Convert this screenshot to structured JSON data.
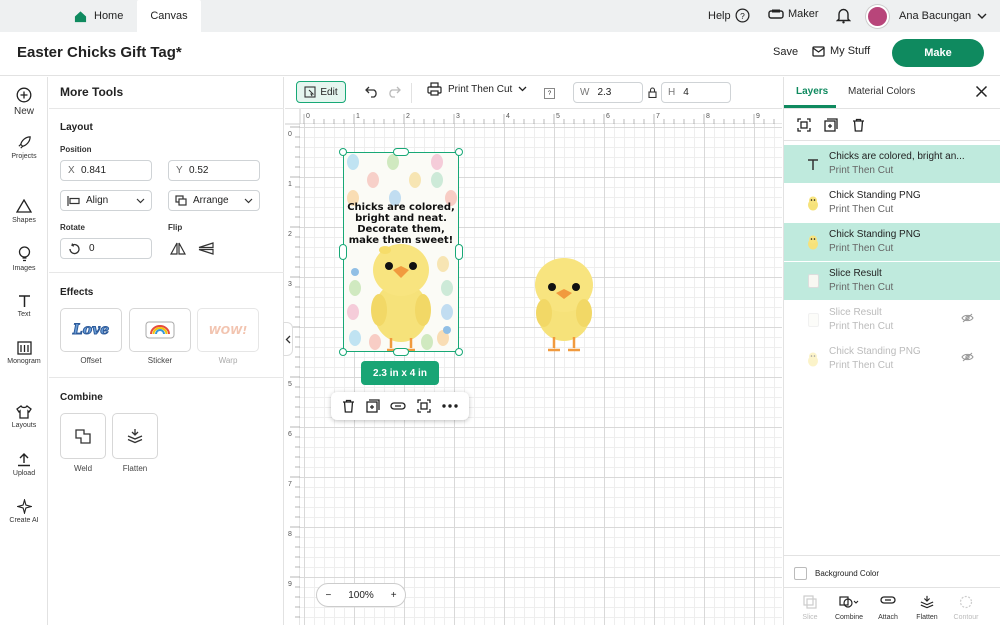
{
  "topbar": {
    "home_label": "Home",
    "canvas_label": "Canvas",
    "help_label": "Help",
    "maker_label": "Maker",
    "user_name": "Ana Bacungan"
  },
  "titlebar": {
    "doc_title": "Easter Chicks Gift Tag*",
    "save_label": "Save",
    "mystuff_label": "My Stuff",
    "make_label": "Make"
  },
  "rail": {
    "items": [
      {
        "label": "New",
        "icon": "plus-circle-icon"
      },
      {
        "label": "Projects",
        "icon": "rocket-icon"
      },
      {
        "label": "Shapes",
        "icon": "shapes-icon"
      },
      {
        "label": "Images",
        "icon": "bulb-icon"
      },
      {
        "label": "Text",
        "icon": "text-icon"
      },
      {
        "label": "Monogram",
        "icon": "monogram-icon"
      },
      {
        "label": "Layouts",
        "icon": "shirt-icon"
      },
      {
        "label": "Upload",
        "icon": "upload-icon"
      },
      {
        "label": "Create AI",
        "icon": "sparkle-icon"
      }
    ]
  },
  "tools": {
    "title": "More Tools",
    "layout_title": "Layout",
    "position_label": "Position",
    "x_prefix": "X",
    "x_value": "0.841",
    "y_prefix": "Y",
    "y_value": "0.52",
    "align_label": "Align",
    "arrange_label": "Arrange",
    "rotate_label": "Rotate",
    "rotate_value": "0",
    "flip_label": "Flip",
    "effects_title": "Effects",
    "offset_label": "Offset",
    "sticker_label": "Sticker",
    "warp_label": "Warp",
    "offset_art": "Love",
    "warp_art": "WOW!",
    "combine_title": "Combine",
    "weld_label": "Weld",
    "flatten_label": "Flatten"
  },
  "canvas": {
    "edit_label": "Edit",
    "operation": "Print Then Cut",
    "help_box": "?",
    "w_prefix": "W",
    "w_value": "2.3",
    "h_prefix": "H",
    "h_value": "4",
    "ruler_h": [
      "0",
      "1",
      "2",
      "3",
      "4",
      "5",
      "6",
      "7",
      "8",
      "9"
    ],
    "ruler_v": [
      "0",
      "1",
      "2",
      "3",
      "4",
      "5",
      "6",
      "7",
      "8",
      "9"
    ],
    "tag_text": "Chicks are colored, bright and neat. Decorate them, make them sweet!",
    "dimensions": "2.3  in x 4  in",
    "zoom": "100%",
    "zoom_minus": "−",
    "zoom_plus": "+"
  },
  "layers_panel": {
    "tab_layers": "Layers",
    "tab_material": "Material Colors",
    "layers": [
      {
        "name": "Chicks are colored, bright an...",
        "op": "Print Then Cut",
        "selected": true,
        "hidden": false,
        "icon": "text-icon"
      },
      {
        "name": "Chick Standing PNG",
        "op": "Print Then Cut",
        "selected": false,
        "hidden": false,
        "icon": "chick-icon"
      },
      {
        "name": "Chick Standing PNG",
        "op": "Print Then Cut",
        "selected": true,
        "hidden": false,
        "icon": "chick-icon"
      },
      {
        "name": "Slice Result",
        "op": "Print Then Cut",
        "selected": true,
        "hidden": false,
        "icon": "slice-icon"
      },
      {
        "name": "Slice Result",
        "op": "Print Then Cut",
        "selected": false,
        "hidden": true,
        "icon": "slice-icon"
      },
      {
        "name": "Chick Standing PNG",
        "op": "Print Then Cut",
        "selected": false,
        "hidden": true,
        "icon": "chick-icon"
      }
    ],
    "background_color_label": "Background Color",
    "bottom_actions": [
      {
        "label": "Slice",
        "disabled": true
      },
      {
        "label": "Combine",
        "disabled": false
      },
      {
        "label": "Attach",
        "disabled": false
      },
      {
        "label": "Flatten",
        "disabled": false
      },
      {
        "label": "Contour",
        "disabled": true
      }
    ]
  },
  "colors": {
    "accent": "#0f8a5f",
    "selection": "#17a876",
    "layer_selected_bg": "#bfeadd"
  }
}
